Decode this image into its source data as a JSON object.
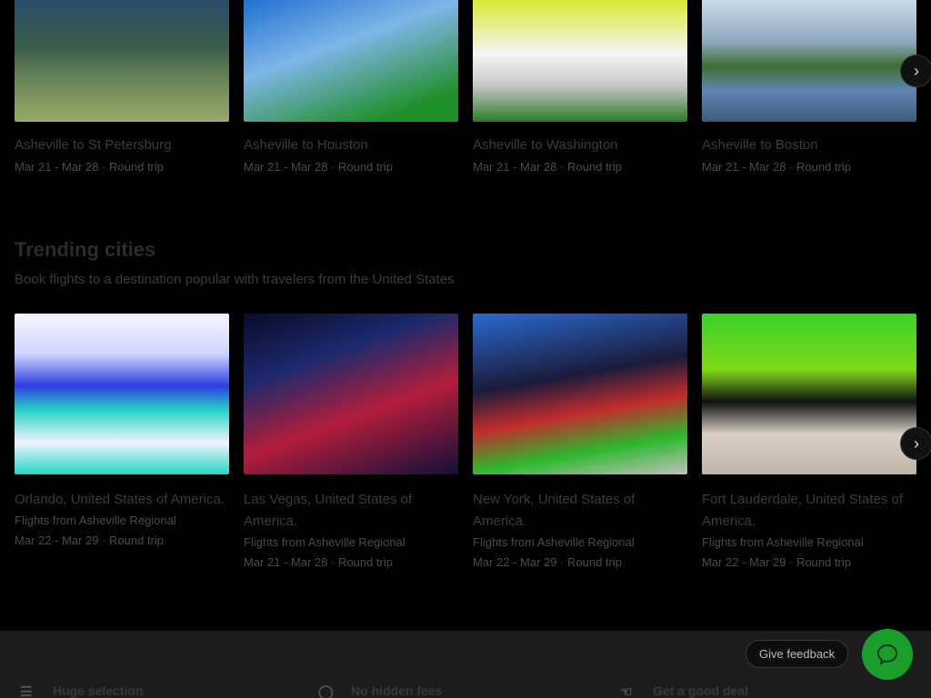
{
  "top_routes": [
    {
      "title": "Asheville to St Petersburg",
      "dates": "Mar 21 - Mar 28 · Round trip"
    },
    {
      "title": "Asheville to Houston",
      "dates": "Mar 21 - Mar 28 · Round trip"
    },
    {
      "title": "Asheville to Washington",
      "dates": "Mar 21 - Mar 28 · Round trip"
    },
    {
      "title": "Asheville to Boston",
      "dates": "Mar 21 - Mar 28 · Round trip"
    }
  ],
  "trending": {
    "title": "Trending cities",
    "subtitle": "Book flights to a destination popular with travelers from the United States",
    "cards": [
      {
        "title": "Orlando, United States of America.",
        "origin": "Flights from Asheville Regional",
        "dates": "Mar 22 - Mar 29 · Round trip"
      },
      {
        "title": "Las Vegas, United States of America.",
        "origin": "Flights from Asheville Regional",
        "dates": "Mar 21 - Mar 28 · Round trip"
      },
      {
        "title": "New York, United States of America.",
        "origin": "Flights from Asheville Regional",
        "dates": "Mar 22 - Mar 29 · Round trip"
      },
      {
        "title": "Fort Lauderdale, United States of America.",
        "origin": "Flights from Asheville Regional",
        "dates": "Mar 22 - Mar 29 · Round trip"
      }
    ]
  },
  "footer": {
    "features": [
      {
        "icon": "filter-icon",
        "label": "Huge selection"
      },
      {
        "icon": "dollar-circle-icon",
        "label": "No hidden fees"
      },
      {
        "icon": "deal-hand-icon",
        "label": "Get a good deal"
      }
    ],
    "feedback_label": "Give feedback"
  },
  "colors": {
    "chat_button": "#1a9e2b",
    "background": "#000000"
  }
}
